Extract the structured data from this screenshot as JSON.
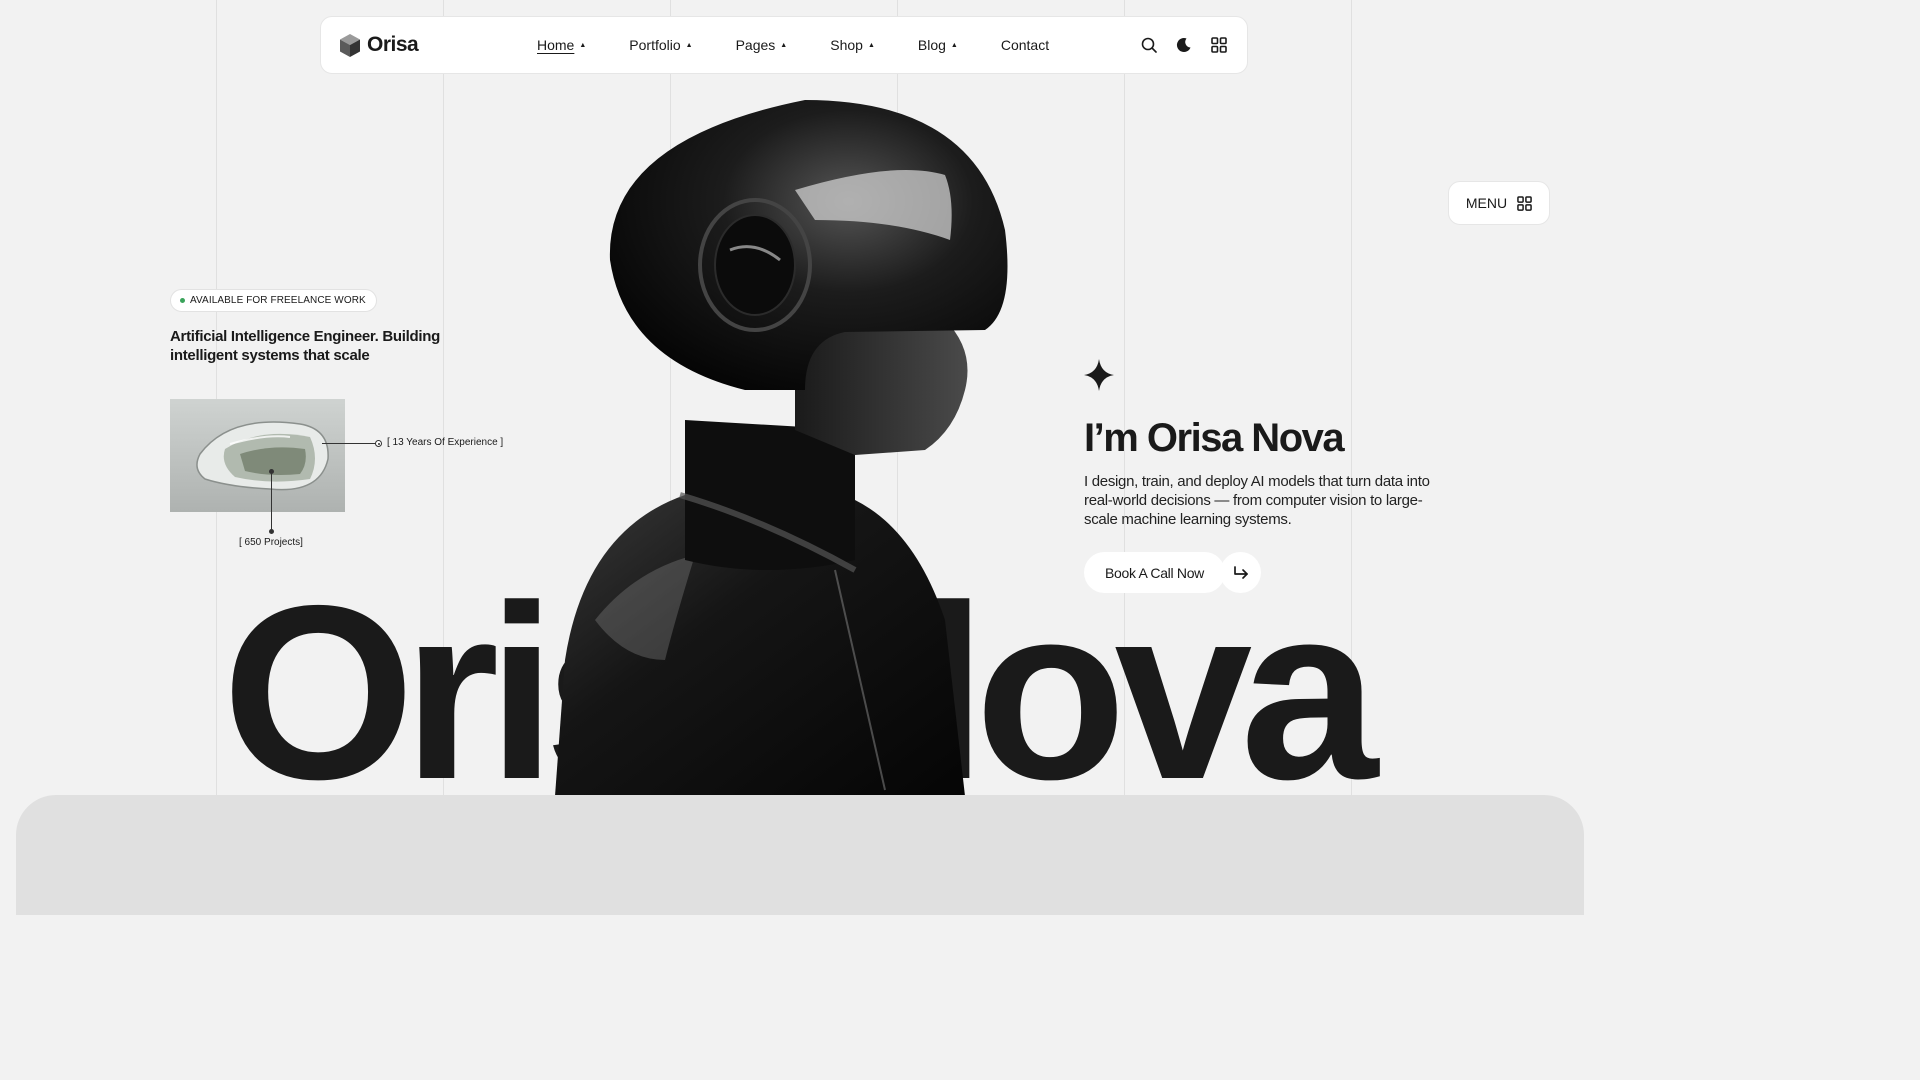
{
  "header": {
    "logo_text": "Orisa",
    "nav": [
      {
        "label": "Home",
        "has_caret": true,
        "active": true
      },
      {
        "label": "Portfolio",
        "has_caret": true
      },
      {
        "label": "Pages",
        "has_caret": true
      },
      {
        "label": "Shop",
        "has_caret": true
      },
      {
        "label": "Blog",
        "has_caret": true
      },
      {
        "label": "Contact",
        "has_caret": false
      }
    ],
    "icons": [
      "search-icon",
      "moon-icon",
      "grid-icon"
    ]
  },
  "menu_button": {
    "label": "MENU",
    "icon": "grid-icon"
  },
  "left": {
    "badge": "AVAILABLE FOR FREELANCE WORK",
    "badge_color": "#3aa35a",
    "tagline": "Artificial Intelligence Engineer. Building intelligent systems that scale",
    "experience": "[ 13 Years Of Experience ]",
    "projects": "[ 650 Projects]"
  },
  "big_name": {
    "left": "Oris",
    "right": "lova"
  },
  "hero": {
    "title": "I’m Orisa Nova",
    "description": "I design, train, and deploy AI models that turn data into real-world decisions — from computer vision to large-scale machine learning systems.",
    "cta_label": "Book A Call Now",
    "cta_icon": "arrow-return-icon"
  }
}
